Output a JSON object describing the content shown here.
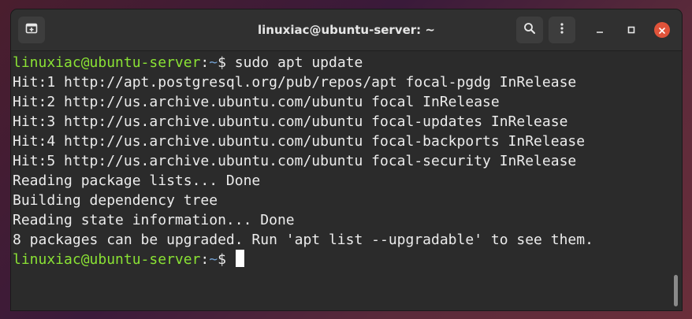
{
  "window": {
    "title": "linuxiac@ubuntu-server: ~"
  },
  "icons": {
    "new_tab": "new-tab-icon",
    "search": "search-icon",
    "menu": "kebab-menu-icon",
    "minimize": "minimize-icon",
    "maximize": "maximize-icon",
    "close": "close-icon"
  },
  "colors": {
    "user_prompt": "#8ae234",
    "path_prompt": "#729fcf",
    "text": "#ececec",
    "close_button": "#e0533a"
  },
  "terminal": {
    "prompt1": {
      "user": "linuxiac@ubuntu-server",
      "sep": ":",
      "path": "~",
      "sym": "$ ",
      "command": "sudo apt update"
    },
    "output": [
      "Hit:1 http://apt.postgresql.org/pub/repos/apt focal-pgdg InRelease",
      "Hit:2 http://us.archive.ubuntu.com/ubuntu focal InRelease",
      "Hit:3 http://us.archive.ubuntu.com/ubuntu focal-updates InRelease",
      "Hit:4 http://us.archive.ubuntu.com/ubuntu focal-backports InRelease",
      "Hit:5 http://us.archive.ubuntu.com/ubuntu focal-security InRelease",
      "Reading package lists... Done",
      "Building dependency tree",
      "Reading state information... Done",
      "8 packages can be upgraded. Run 'apt list --upgradable' to see them."
    ],
    "prompt2": {
      "user": "linuxiac@ubuntu-server",
      "sep": ":",
      "path": "~",
      "sym": "$ "
    }
  }
}
